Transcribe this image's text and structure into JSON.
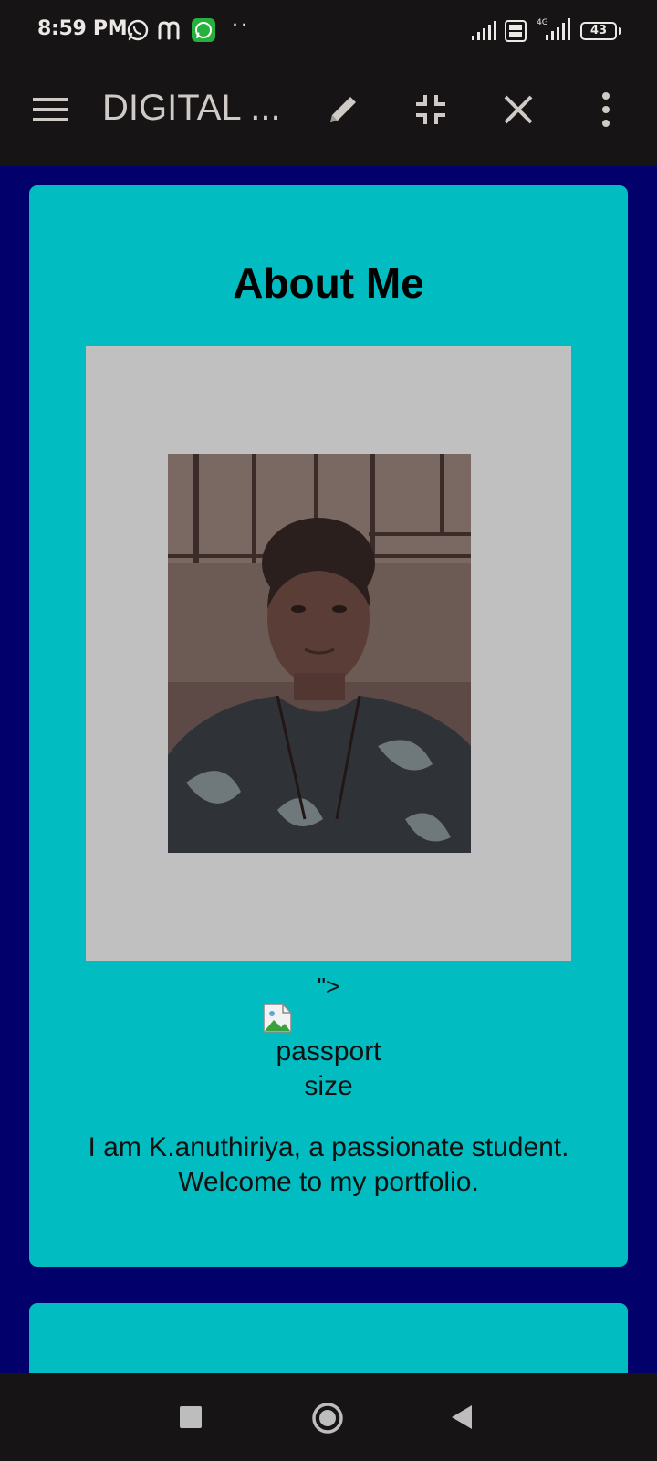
{
  "status_bar": {
    "time": "8:59 PM",
    "dots": "··",
    "battery": "43",
    "icons": [
      "whatsapp-icon",
      "m-app-icon",
      "whatsapp-business-icon",
      "signal-icon",
      "volte-icon",
      "4g-signal-icon",
      "battery-icon"
    ]
  },
  "app_bar": {
    "title": "DIGITAL ...",
    "icons": [
      "menu-icon",
      "pencil-icon",
      "collapse-icon",
      "close-icon",
      "more-vert-icon"
    ]
  },
  "about": {
    "title": "About Me",
    "stray_text": "\">",
    "image_alt_line1": "passport",
    "image_alt_line2": "size",
    "intro_line1": "I am K.anuthiriya, a passionate student.",
    "intro_line2": "Welcome to my portfolio."
  },
  "nav_bar": {
    "icons": [
      "recents-icon",
      "home-icon",
      "back-icon"
    ]
  },
  "colors": {
    "page_background": "#02006b",
    "card": "#01bcc0",
    "bars": "#161414",
    "photo_frame": "#c0c0c0"
  }
}
